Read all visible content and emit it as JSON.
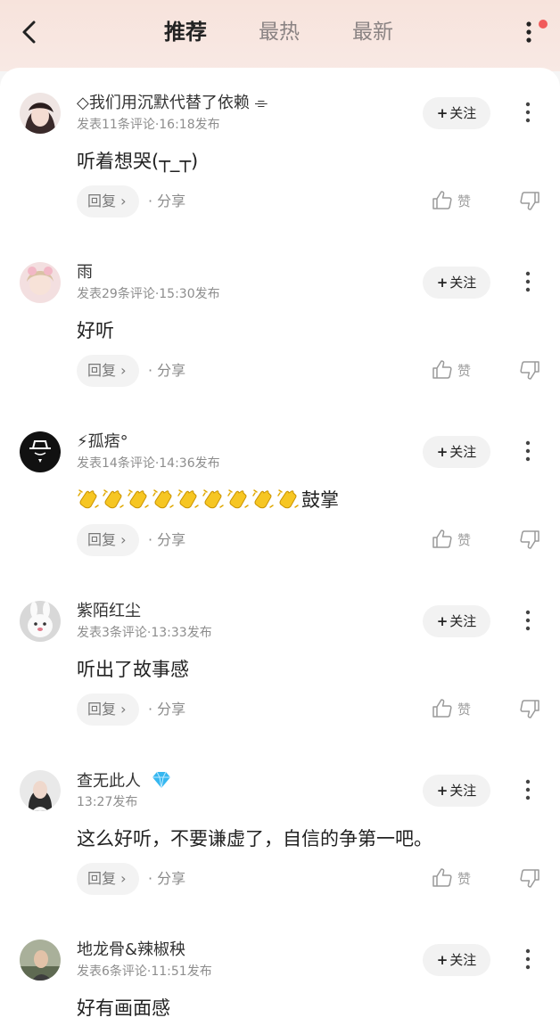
{
  "header": {
    "tabs": [
      "推荐",
      "最热",
      "最新"
    ],
    "active_tab": 0
  },
  "colors": {
    "accent_dot": "#f15b5b",
    "gem_badge": "#36b7f0"
  },
  "icons": [
    "back-icon",
    "more-vertical-icon",
    "thumbs-up-icon",
    "thumbs-down-icon",
    "clapping-hands-emoji",
    "diamond-badge-icon"
  ],
  "common": {
    "follow_label": "关注",
    "follow_plus": "+",
    "reply_label": "回复 ›",
    "share_label": "·  分享",
    "like_label": "赞"
  },
  "comments": [
    {
      "user": "◇我们用沉默代替了依赖 ⌯",
      "meta": "发表11条评论·16:18发布",
      "text": "听着想哭(┬_┬)"
    },
    {
      "user": "雨",
      "meta": "发表29条评论·15:30发布",
      "text": "好听"
    },
    {
      "user": "⚡孤痞°",
      "meta": "发表14条评论·14:36发布",
      "text": "鼓掌",
      "clap_count": 9
    },
    {
      "user": "紫陌红尘",
      "meta": "发表3条评论·13:33发布",
      "text": "听出了故事感"
    },
    {
      "user": "查无此人",
      "meta": "13:27发布",
      "text": "这么好听，不要谦虚了，自信的争第一吧。",
      "badge": "diamond"
    },
    {
      "user": "地龙骨&辣椒秧",
      "meta": "发表6条评论·11:51发布",
      "text": "好有画面感"
    }
  ]
}
